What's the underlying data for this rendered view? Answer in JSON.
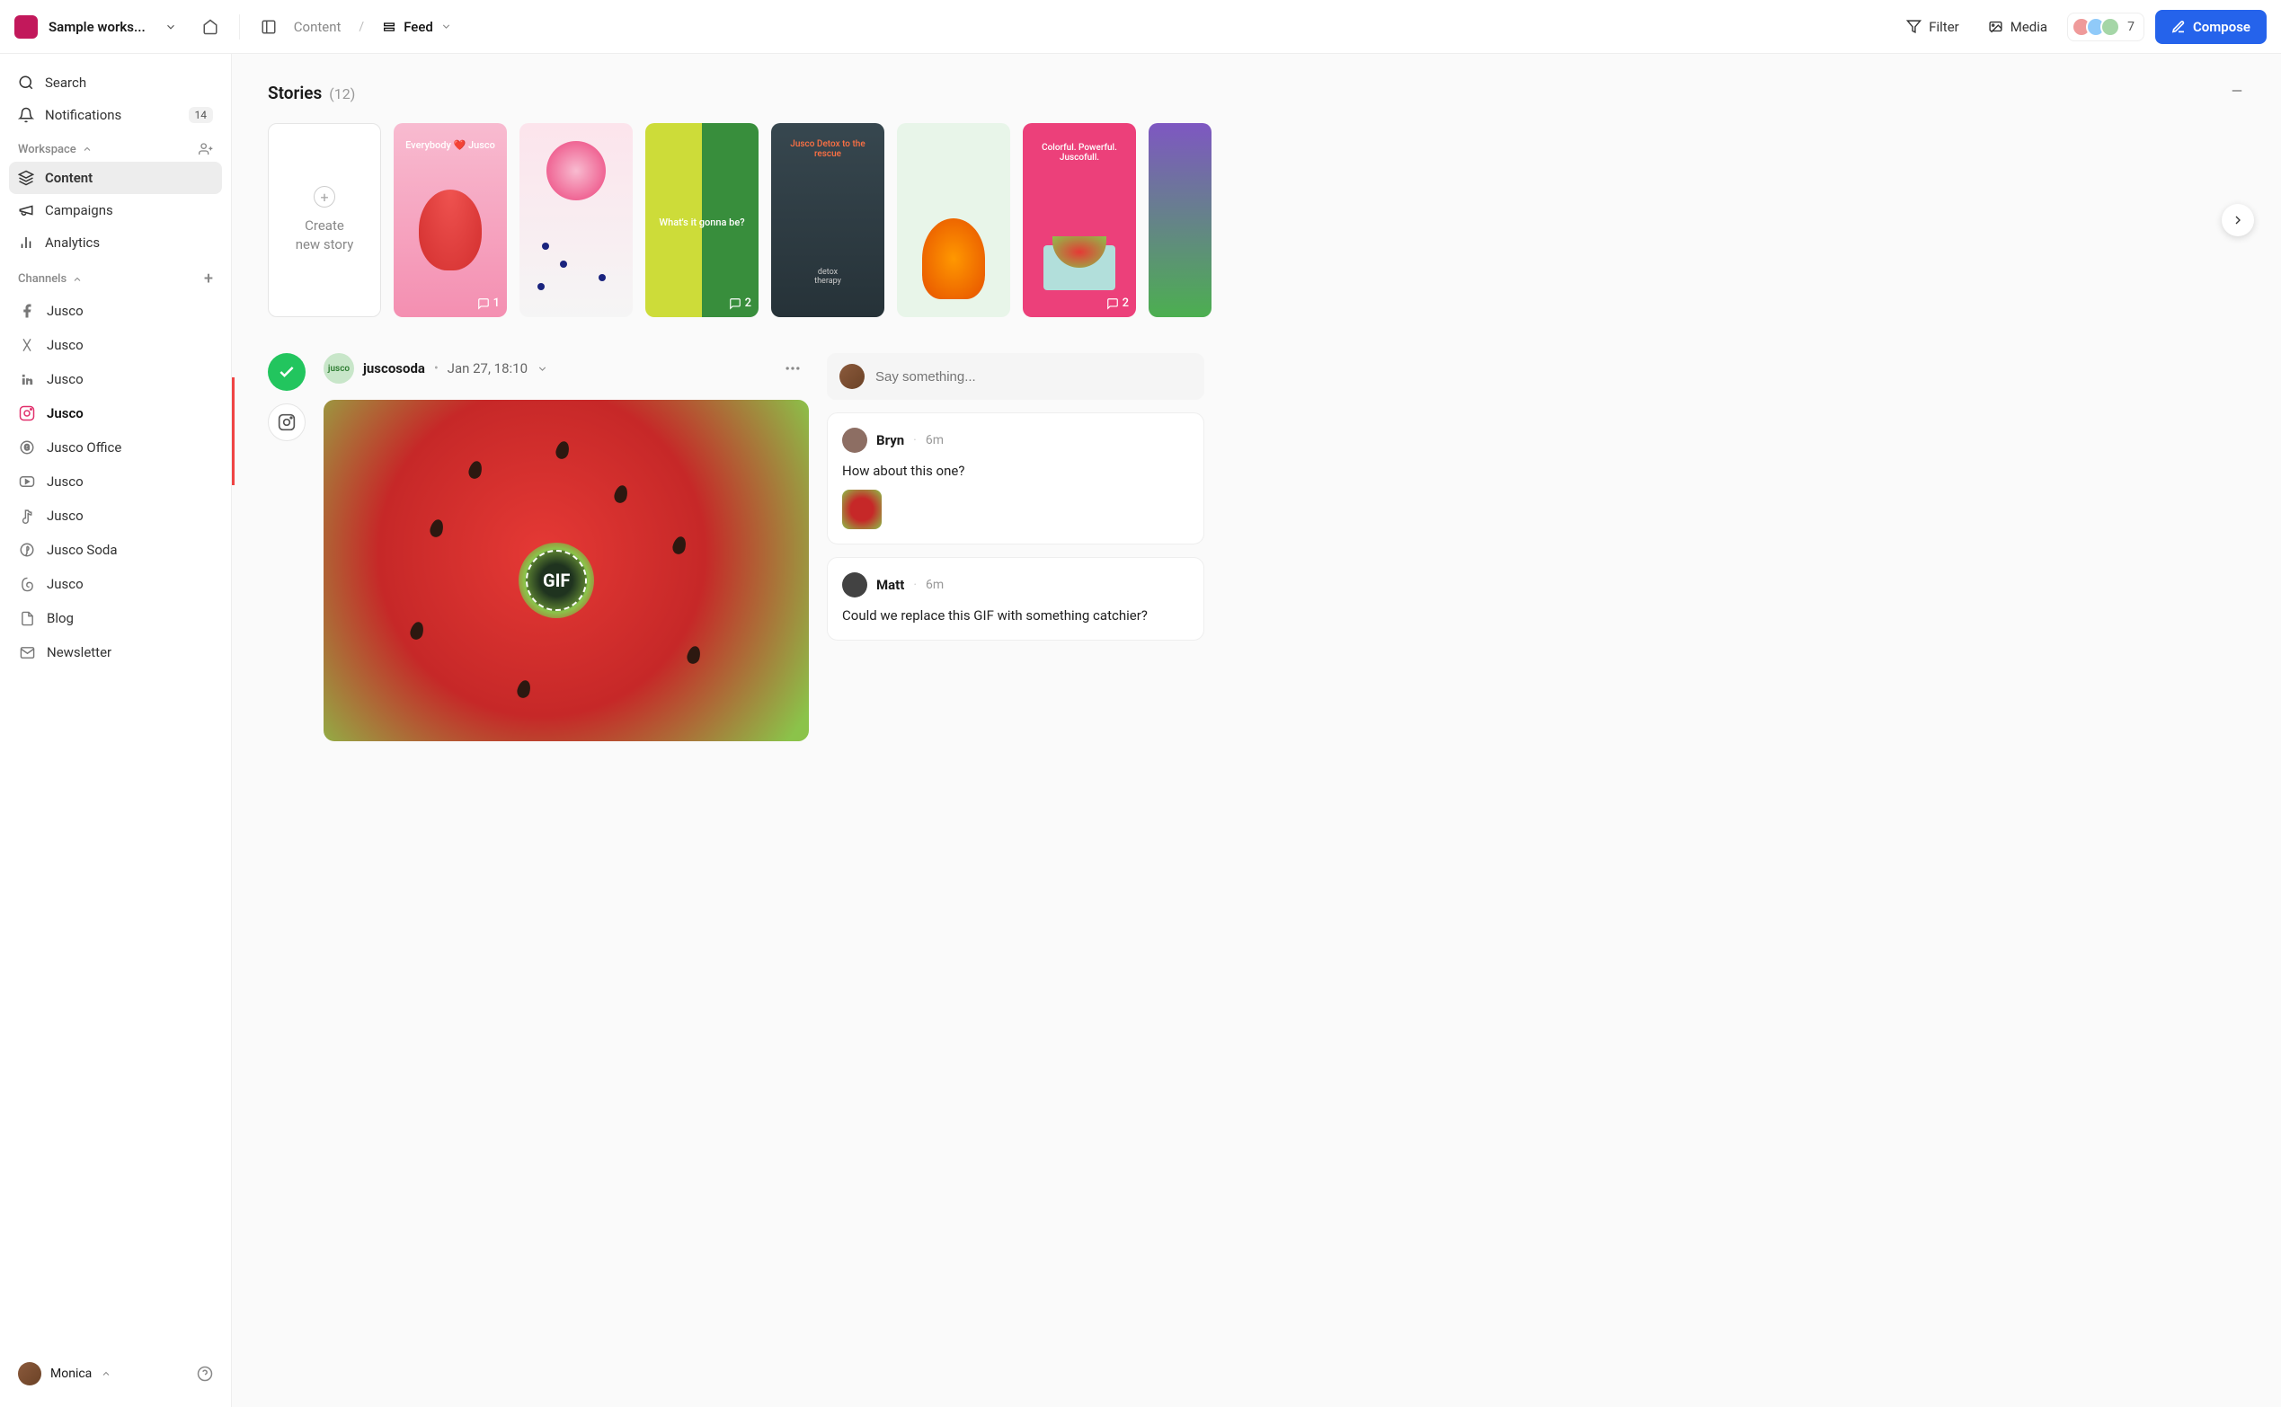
{
  "workspace_name": "Sample works...",
  "breadcrumb": {
    "parent": "Content",
    "current": "Feed"
  },
  "topbar": {
    "filter_label": "Filter",
    "media_label": "Media",
    "member_count": "7",
    "compose_label": "Compose"
  },
  "sidebar": {
    "search_label": "Search",
    "notifications_label": "Notifications",
    "notifications_count": "14",
    "workspace_section": "Workspace",
    "items": [
      {
        "label": "Content"
      },
      {
        "label": "Campaigns"
      },
      {
        "label": "Analytics"
      }
    ],
    "channels_section": "Channels",
    "channels": [
      {
        "label": "Jusco",
        "platform": "facebook"
      },
      {
        "label": "Jusco",
        "platform": "x"
      },
      {
        "label": "Jusco",
        "platform": "linkedin"
      },
      {
        "label": "Jusco",
        "platform": "instagram"
      },
      {
        "label": "Jusco Office",
        "platform": "google"
      },
      {
        "label": "Jusco",
        "platform": "youtube"
      },
      {
        "label": "Jusco",
        "platform": "tiktok"
      },
      {
        "label": "Jusco Soda",
        "platform": "pinterest"
      },
      {
        "label": "Jusco",
        "platform": "threads"
      },
      {
        "label": "Blog",
        "platform": "doc"
      },
      {
        "label": "Newsletter",
        "platform": "mail"
      }
    ],
    "user_name": "Monica"
  },
  "stories": {
    "title": "Stories",
    "count": "(12)",
    "create_label": "Create\nnew story",
    "cards": [
      {
        "bg": "#f8bbd0",
        "text": "Everybody ❤️ Jusco",
        "comments": "1"
      },
      {
        "bg": "#fce4ec",
        "text": ""
      },
      {
        "bg": "#cddc39",
        "text": "What's it gonna be?",
        "comments": "2"
      },
      {
        "bg": "#263238",
        "text": "Jusco Detox to the rescue"
      },
      {
        "bg": "#e8f5e9",
        "text": ""
      },
      {
        "bg": "#ec407a",
        "text": "Colorful. Powerful. Juscofull.",
        "comments": "2"
      },
      {
        "bg": "#7e57c2",
        "text": ""
      }
    ]
  },
  "post": {
    "author": "juscosoda",
    "date": "Jan 27, 18:10",
    "gif_label": "GIF"
  },
  "comments": {
    "placeholder": "Say something...",
    "list": [
      {
        "author": "Bryn",
        "time": "6m",
        "body": "How about this one?",
        "has_thumb": true,
        "avatar_bg": "#8d6e63"
      },
      {
        "author": "Matt",
        "time": "6m",
        "body": "Could we replace this GIF with something catchier?",
        "has_thumb": false,
        "avatar_bg": "#424242"
      }
    ]
  }
}
